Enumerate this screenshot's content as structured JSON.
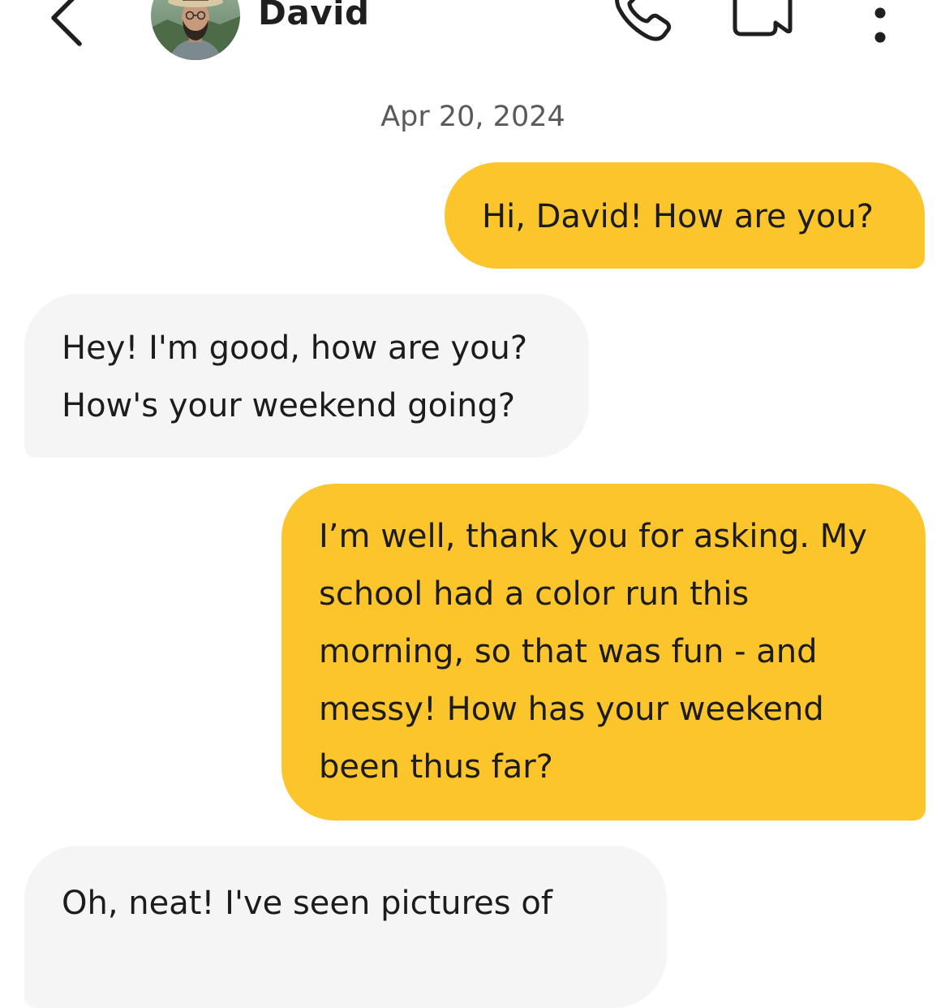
{
  "header": {
    "contact_name": "David",
    "icons": {
      "back": "chevron-left-icon",
      "call": "phone-icon",
      "video": "video-camera-icon",
      "more": "more-vertical-icon"
    }
  },
  "conversation": {
    "date": "Apr 20, 2024",
    "messages": [
      {
        "direction": "outgoing",
        "lines": [
          "Hi, David! How are you?"
        ]
      },
      {
        "direction": "incoming",
        "lines": [
          "Hey! I'm good, how are you?",
          "How's your weekend going?"
        ]
      },
      {
        "direction": "outgoing",
        "lines": [
          "I’m well, thank you for asking. My",
          "school had a color run this",
          "morning, so that was fun - and",
          "messy! How has your weekend",
          "been thus far?"
        ]
      },
      {
        "direction": "incoming",
        "lines": [
          "Oh, neat! I've seen pictures of"
        ]
      }
    ]
  },
  "colors": {
    "outgoing_bubble": "#fcc52c",
    "incoming_bubble": "#f5f5f5",
    "text": "#1c1c1c",
    "date_text": "#5a5a5a"
  }
}
